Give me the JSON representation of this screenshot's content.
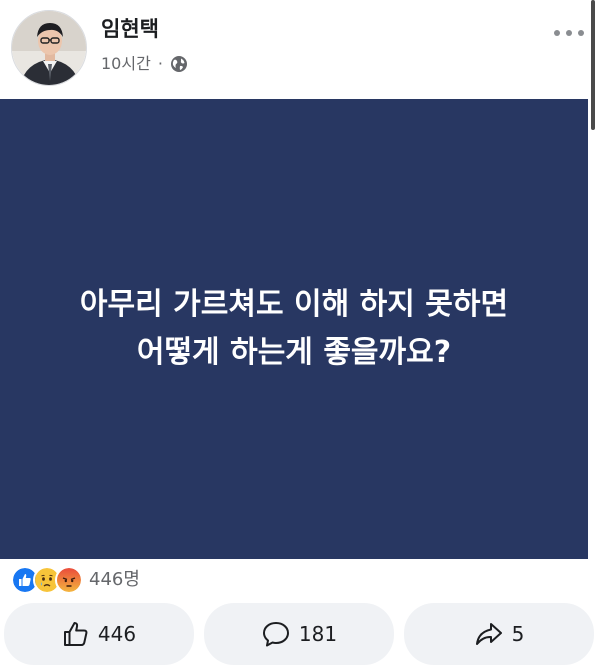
{
  "post": {
    "author_name": "임현택",
    "time": "10시간",
    "separator": "·",
    "card_line_1": "아무리 가르쳐도 이해 하지 못하면",
    "card_line_2": "어떻게 하는게 좋을까요?",
    "reaction_summary": "446명",
    "reactions": [
      "like-icon",
      "sad-icon",
      "angry-icon"
    ]
  },
  "actions": {
    "like_count": "446",
    "comment_count": "181",
    "share_count": "5"
  },
  "colors": {
    "card_background": "#283762",
    "card_text": "#ffffff",
    "like_blue": "#1877f2",
    "button_background": "#f0f2f5"
  }
}
